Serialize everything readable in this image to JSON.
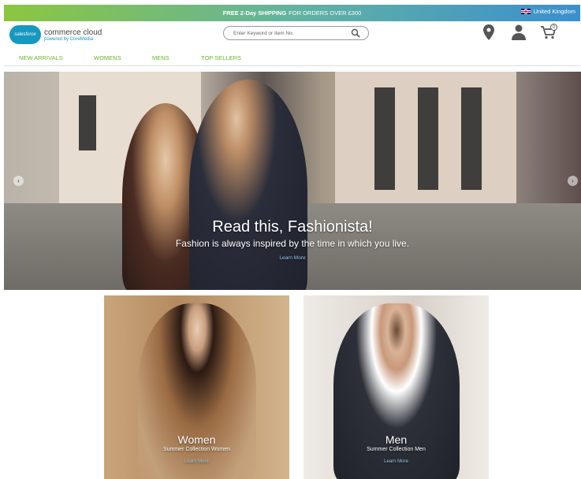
{
  "promo": {
    "bold": "FREE 2-Day SHIPPING",
    "rest": "FOR ORDERS OVER £300"
  },
  "region": {
    "label": "United Kingdom",
    "flag_icon": "uk-flag-icon"
  },
  "logo": {
    "badge": "salesforce",
    "line1": "commerce cloud",
    "line2": "powered by CoreMedia"
  },
  "search": {
    "placeholder": "Enter Keyword or Item No."
  },
  "header_icons": {
    "cart_count": "0",
    "icons": [
      "location-pin-icon",
      "user-icon",
      "cart-icon"
    ]
  },
  "nav": [
    {
      "label": "NEW ARRIVALS"
    },
    {
      "label": "WOMENS"
    },
    {
      "label": "MENS"
    },
    {
      "label": "TOP SELLERS"
    }
  ],
  "hero": {
    "title": "Read this, Fashionista!",
    "subtitle": "Fashion is always inspired by the time in which you live.",
    "link": "Learn More"
  },
  "tiles": [
    {
      "title": "Women",
      "subtitle": "Summer Collection Women",
      "link": "Learn More"
    },
    {
      "title": "Men",
      "subtitle": "Summer Collection Men",
      "link": "Learn More"
    }
  ],
  "colors": {
    "nav_accent": "#6ab42d",
    "promo_start": "#8cc63f",
    "promo_end": "#3b8fcf",
    "salesforce_blue": "#1798c1",
    "link_blue": "#8fc7e8"
  }
}
